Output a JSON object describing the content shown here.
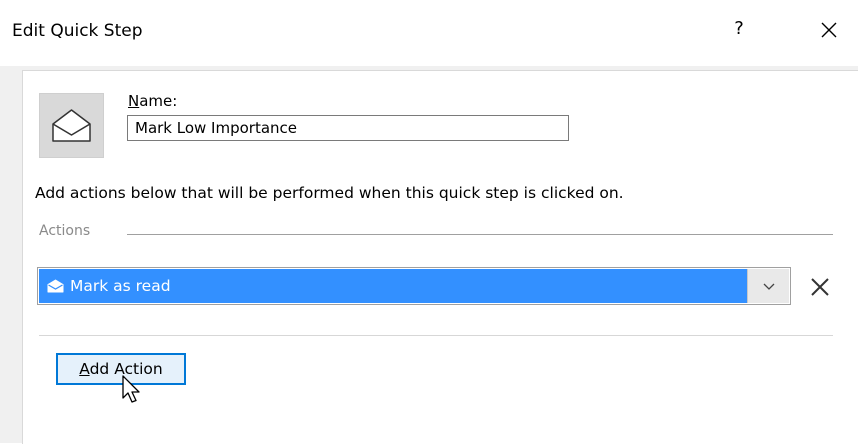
{
  "dialog": {
    "title": "Edit Quick Step",
    "help_label": "?",
    "close_label": "✕"
  },
  "name_field": {
    "label_accel": "N",
    "label_rest": "ame:",
    "value": "Mark Low Importance"
  },
  "instructions": "Add actions below that will be performed when this quick step is clicked on.",
  "actions_section": {
    "label": "Actions",
    "items": [
      {
        "label": "Mark as read",
        "icon": "envelope-open-icon",
        "selected": true
      }
    ],
    "remove_icon": "close-icon"
  },
  "add_action_button": {
    "accel": "A",
    "rest": "dd Action"
  },
  "colors": {
    "selection": "#3390ff",
    "focus_border": "#0078d7"
  }
}
